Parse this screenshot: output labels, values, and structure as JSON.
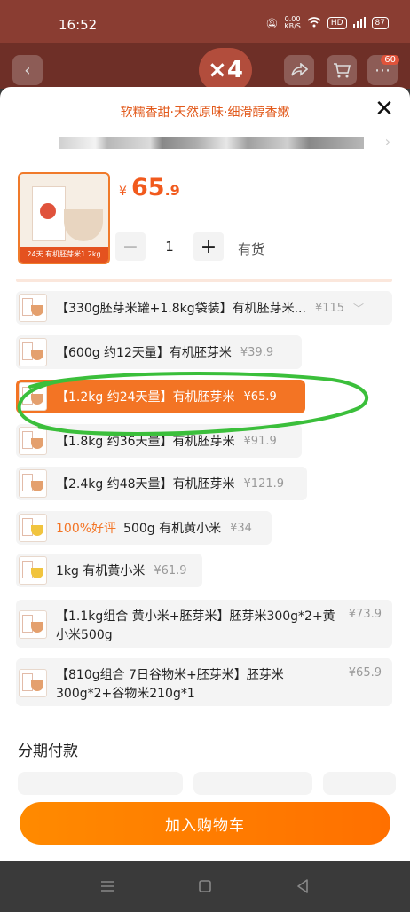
{
  "status_bar": {
    "time": "16:52",
    "net_speed_top": "0.00",
    "net_speed_unit": "KB/S",
    "hd": "HD",
    "battery": "87"
  },
  "background_page": {
    "cart_badge": "60",
    "banner_text": "×4"
  },
  "sheet": {
    "slogan": "软糯香甜·天然原味·细滑醇香嫩",
    "image_caption": "有机胚芽米1.2kg",
    "image_corner": "24天",
    "price": {
      "currency": "¥",
      "integer": "65",
      "decimal": ".9"
    },
    "quantity": "1",
    "stock": "有货",
    "options": [
      {
        "label": "【330g胚芽米罐+1.8kg袋装】有机胚芽米...",
        "price": "¥115"
      },
      {
        "label": "【600g 约12天量】有机胚芽米",
        "price": "¥39.9"
      },
      {
        "label": "【1.2kg 约24天量】有机胚芽米",
        "price": "¥65.9"
      },
      {
        "label": "【1.8kg 约36天量】有机胚芽米",
        "price": "¥91.9"
      },
      {
        "label": "【2.4kg 约48天量】有机胚芽米",
        "price": "¥121.9"
      },
      {
        "highlight": "100%好评",
        "label": "500g 有机黄小米",
        "price": "¥34"
      },
      {
        "label": "1kg 有机黄小米",
        "price": "¥61.9"
      },
      {
        "label": "【1.1kg组合 黄小米+胚芽米】胚芽米300g*2+黄小米500g",
        "price": "¥73.9"
      },
      {
        "label": "【810g组合 7日谷物米+胚芽米】胚芽米300g*2+谷物米210g*1",
        "price": "¥65.9"
      }
    ],
    "installment_title": "分期付款",
    "add_to_cart": "加入购物车"
  },
  "colors": {
    "accent": "#f37424",
    "button": "#ff7d00",
    "annotation": "#3bbf3b"
  }
}
